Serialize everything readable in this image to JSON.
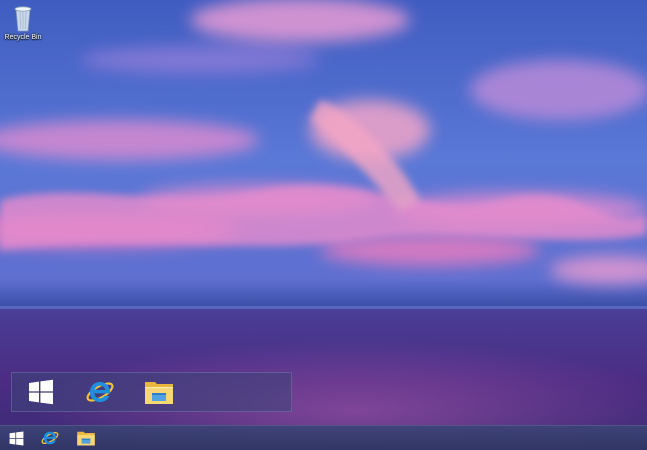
{
  "desktop": {
    "icons": [
      {
        "label": "Recycle Bin",
        "icon": "recycle-bin-icon"
      }
    ]
  },
  "pinned_panel": {
    "items": [
      {
        "icon": "windows-start-icon"
      },
      {
        "icon": "internet-explorer-icon"
      },
      {
        "icon": "file-explorer-icon"
      }
    ]
  },
  "taskbar": {
    "items": [
      {
        "icon": "windows-start-icon"
      },
      {
        "icon": "internet-explorer-icon"
      },
      {
        "icon": "file-explorer-icon"
      }
    ]
  },
  "colors": {
    "sky_top": "#4a63c4",
    "cloud_pink": "#e99ad0",
    "horizon": "#3a4aa0",
    "sea": "#4a2a7a",
    "taskbar": "#3c4478",
    "accent_blue": "#1e8fe0",
    "folder_yellow": "#f2c94c"
  }
}
